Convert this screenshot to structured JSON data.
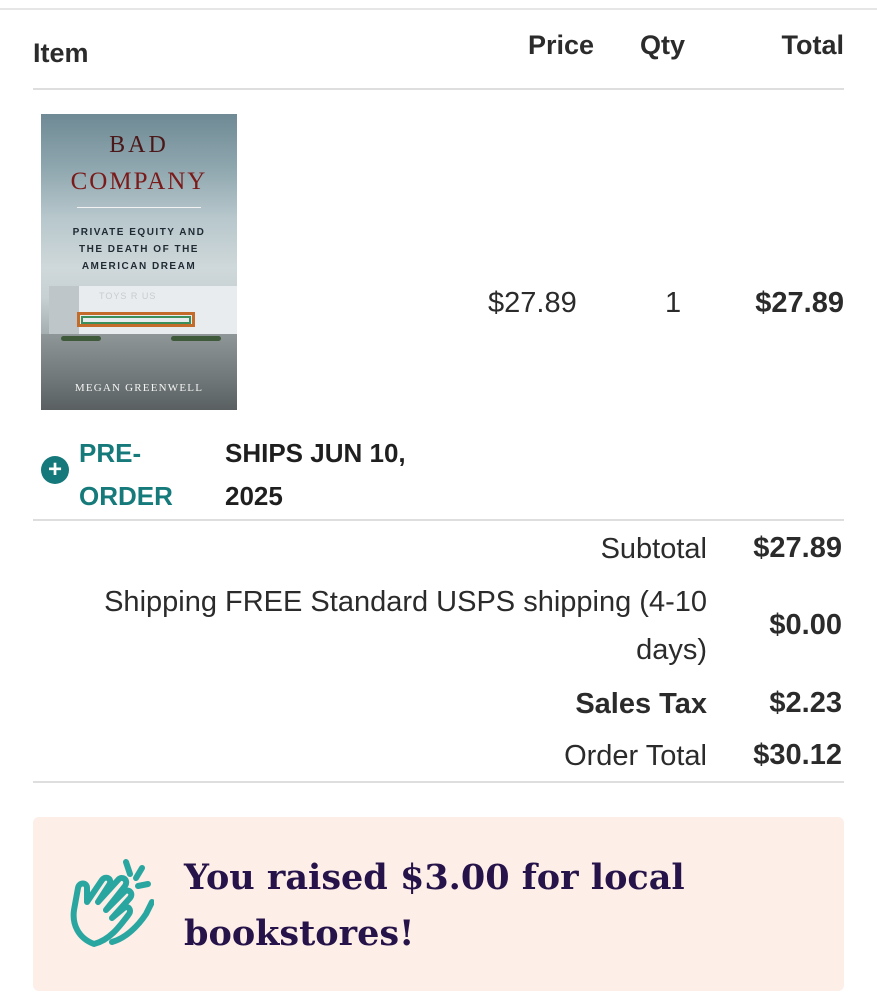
{
  "table": {
    "headers": {
      "item": "Item",
      "price": "Price",
      "qty": "Qty",
      "total": "Total"
    }
  },
  "line_item": {
    "cover": {
      "title_line1": "BAD",
      "title_line2": "COMPANY",
      "subtitle": "PRIVATE EQUITY AND\nTHE DEATH OF THE\nAMERICAN DREAM",
      "sign": "TOYS R US",
      "author": "MEGAN GREENWELL"
    },
    "price": "$27.89",
    "qty": "1",
    "total": "$27.89",
    "preorder_label": "PRE-ORDER",
    "ships": "SHIPS JUN 10, 2025"
  },
  "summary": {
    "subtotal_label": "Subtotal",
    "subtotal_value": "$27.89",
    "shipping_label": "Shipping FREE Standard USPS shipping (4-10 days)",
    "shipping_value": "$0.00",
    "tax_label": "Sales Tax",
    "tax_value": "$2.23",
    "order_total_label": "Order Total",
    "order_total_value": "$30.12"
  },
  "banner": {
    "message": "You raised $3.00 for local bookstores!",
    "icon": "clapping-hands-icon",
    "bg_color": "#fdeee7",
    "text_color": "#26134a",
    "icon_color": "#2aa6a1"
  },
  "colors": {
    "accent": "#167a7a"
  }
}
